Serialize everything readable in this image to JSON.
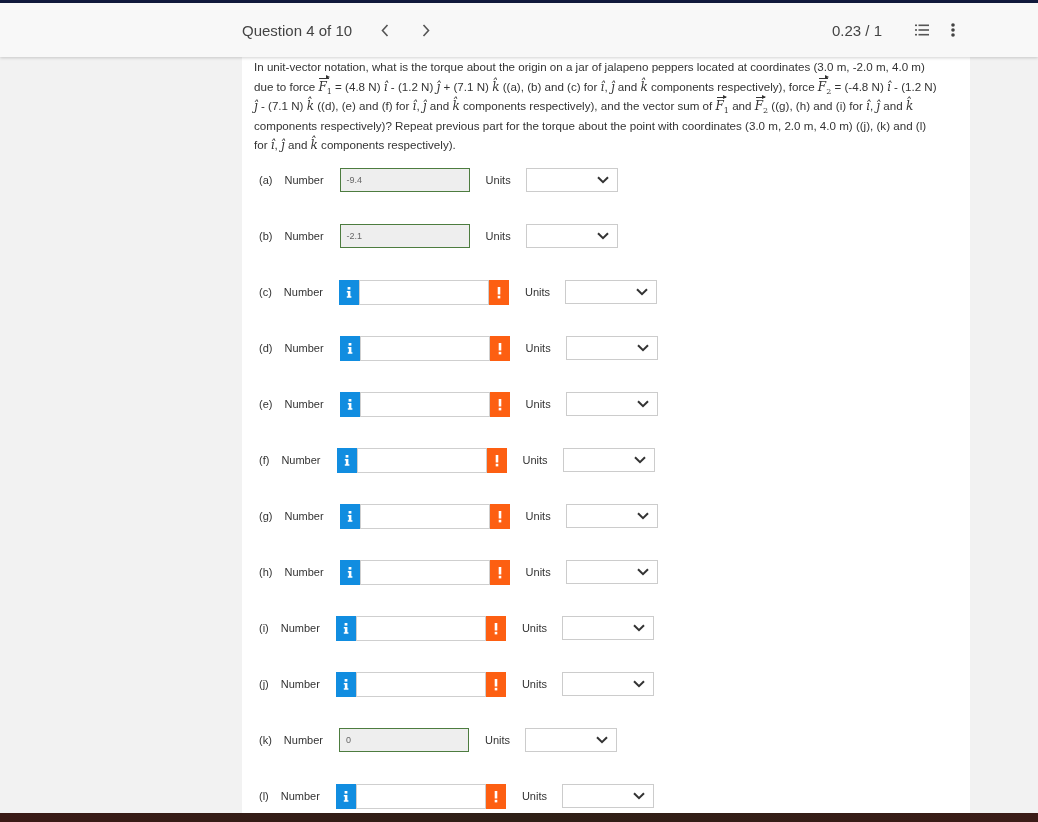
{
  "header": {
    "title": "Question 4 of 10",
    "score": "0.23 / 1"
  },
  "question": {
    "text": "In unit-vector notation, what is the torque about the origin on a jar of jalapeno peppers located at coordinates (3.0 m, -2.0 m, 4.0 m) due to force *F*$_{1}$ = (4.8 N) *î* - (1.2 N) *ĵ* + (7.1 N) *k̂* ((a), (b) and (c) for *î*, *ĵ* and *k̂* components respectively), force *F*$_{2}$ = (-4.8 N) *î* - (1.2 N) *ĵ* - (7.1 N) *k̂* ((d), (e) and (f) for *î*, *ĵ* and *k̂* components respectively), and the vector sum of *F*$_{1}$ and *F*$_{2}$ ((g), (h) and (i) for *î*, *ĵ* and *k̂* components respectively)? Repeat previous part for the torque about the point with coordinates (3.0 m, 2.0 m, 4.0 m) ((j), (k) and (l) for *î*, *ĵ* and *k̂* components respectively)."
  },
  "parts": [
    {
      "label": "(a)",
      "field_label": "Number",
      "correct": true,
      "value": "-9.4",
      "units_label": "Units"
    },
    {
      "label": "(b)",
      "field_label": "Number",
      "correct": true,
      "value": "-2.1",
      "units_label": "Units"
    },
    {
      "label": "(c)",
      "field_label": "Number",
      "correct": false,
      "units_label": "Units"
    },
    {
      "label": "(d)",
      "field_label": "Number",
      "correct": false,
      "units_label": "Units"
    },
    {
      "label": "(e)",
      "field_label": "Number",
      "correct": false,
      "units_label": "Units"
    },
    {
      "label": "(f)",
      "field_label": "Number",
      "correct": false,
      "units_label": "Units"
    },
    {
      "label": "(g)",
      "field_label": "Number",
      "correct": false,
      "units_label": "Units"
    },
    {
      "label": "(h)",
      "field_label": "Number",
      "correct": false,
      "units_label": "Units"
    },
    {
      "label": "(i)",
      "field_label": "Number",
      "correct": false,
      "units_label": "Units"
    },
    {
      "label": "(j)",
      "field_label": "Number",
      "correct": false,
      "units_label": "Units"
    },
    {
      "label": "(k)",
      "field_label": "Number",
      "correct": true,
      "value": "0",
      "units_label": "Units"
    },
    {
      "label": "(l)",
      "field_label": "Number",
      "correct": false,
      "units_label": "Units"
    }
  ]
}
